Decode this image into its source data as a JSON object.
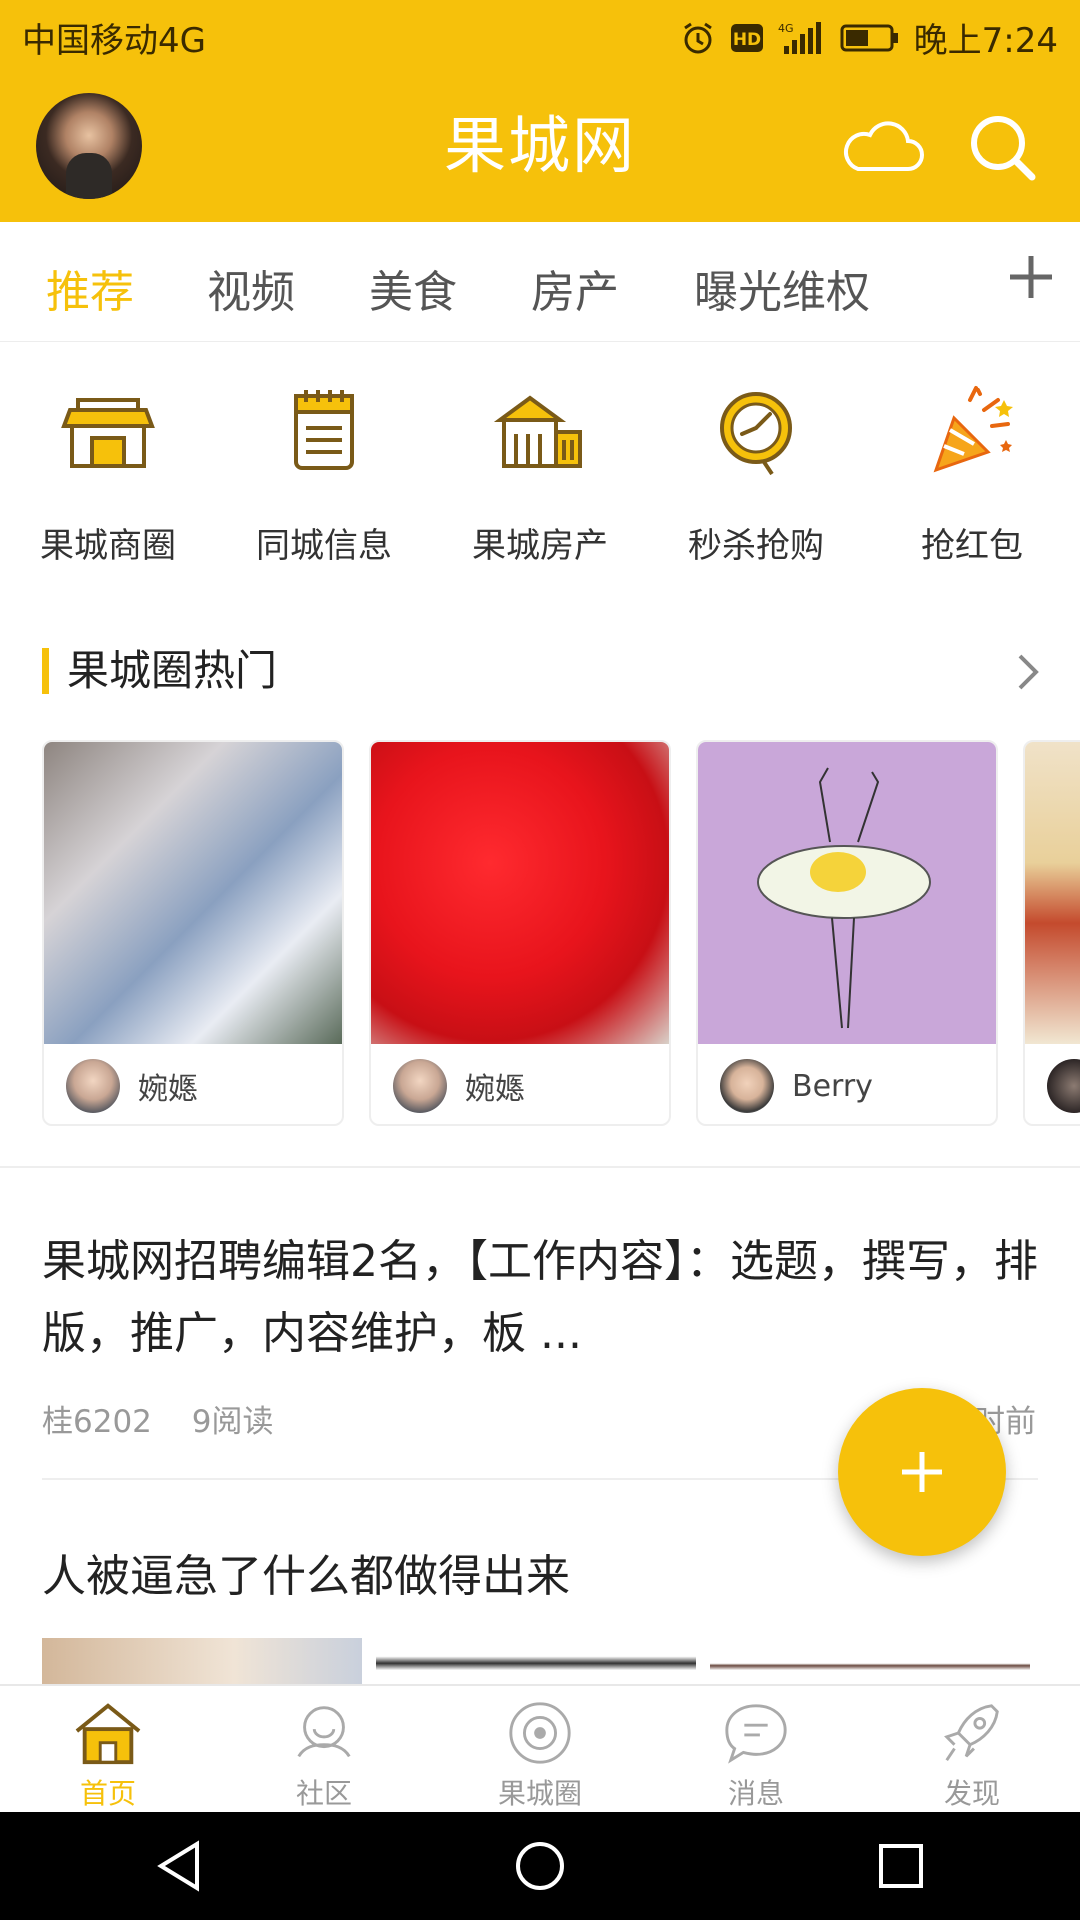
{
  "status": {
    "carrier": "中国移动4G",
    "time": "晚上7:24"
  },
  "header": {
    "title": "果城网"
  },
  "tabs": [
    {
      "label": "推荐"
    },
    {
      "label": "视频"
    },
    {
      "label": "美食"
    },
    {
      "label": "房产"
    },
    {
      "label": "曝光维权"
    }
  ],
  "quick_links": [
    {
      "label": "果城商圈",
      "icon": "shop-icon"
    },
    {
      "label": "同城信息",
      "icon": "notepad-icon"
    },
    {
      "label": "果城房产",
      "icon": "building-icon"
    },
    {
      "label": "秒杀抢购",
      "icon": "clock-icon"
    },
    {
      "label": "抢红包",
      "icon": "party-popper-icon"
    }
  ],
  "hot_section": {
    "title": "果城圈热门",
    "cards": [
      {
        "name": "婉嫕"
      },
      {
        "name": "婉嫕"
      },
      {
        "name": "Berry"
      },
      {
        "name": ""
      }
    ]
  },
  "posts": [
    {
      "title": "果城网招聘编辑2名，【工作内容】：选题，撰写，排版，推广，内容维护，板 ...",
      "author": "桂6202",
      "reads": "9阅读",
      "time": "时前"
    },
    {
      "title": "人被逼急了什么都做得出来"
    }
  ],
  "bottom_nav": [
    {
      "label": "首页",
      "icon": "home-icon",
      "active": true
    },
    {
      "label": "社区",
      "icon": "community-icon"
    },
    {
      "label": "果城圈",
      "icon": "circle-icon"
    },
    {
      "label": "消息",
      "icon": "message-icon"
    },
    {
      "label": "发现",
      "icon": "rocket-icon"
    }
  ],
  "colors": {
    "accent": "#f6c10b"
  }
}
